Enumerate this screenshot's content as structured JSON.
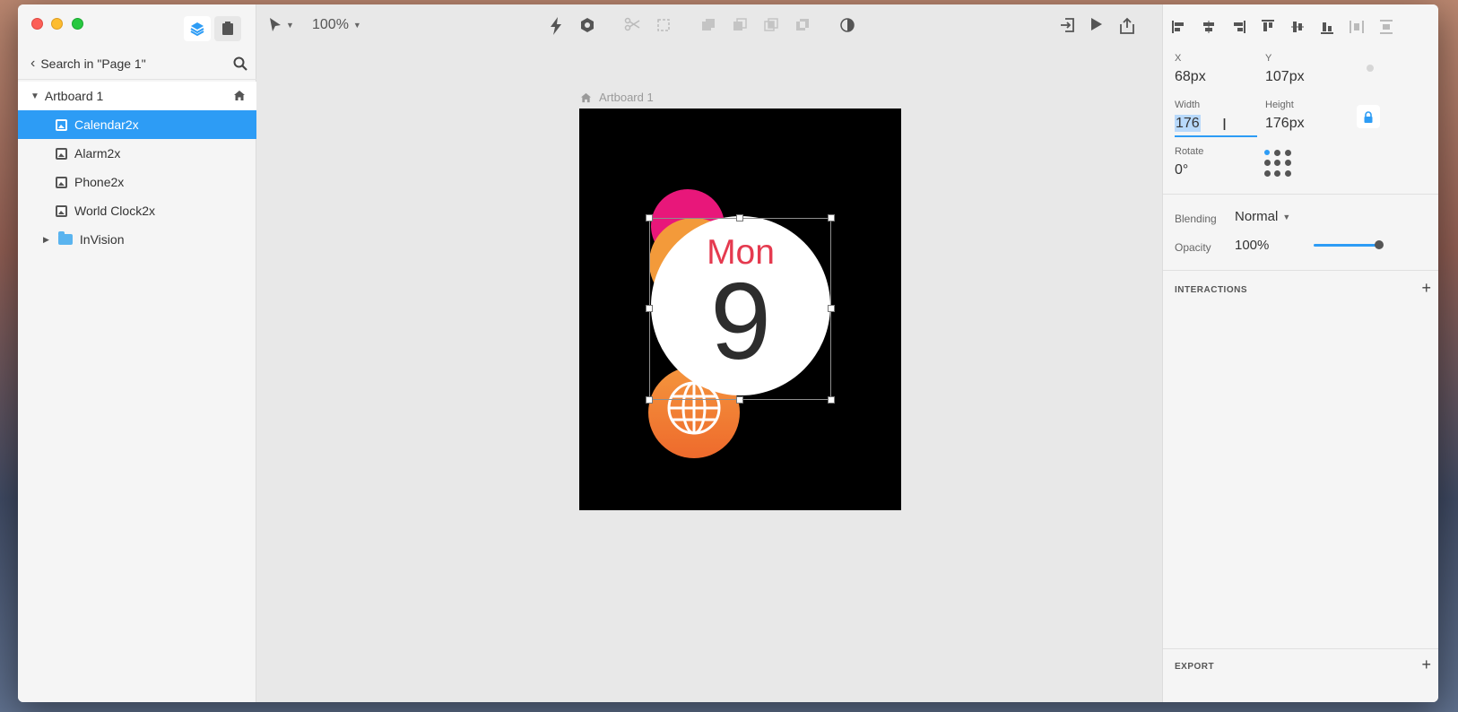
{
  "left_panel": {
    "search_label": "Search in \"Page 1\"",
    "artboard": "Artboard 1",
    "layers": [
      {
        "label": "Calendar2x",
        "selected": true
      },
      {
        "label": "Alarm2x",
        "selected": false
      },
      {
        "label": "Phone2x",
        "selected": false
      },
      {
        "label": "World Clock2x",
        "selected": false
      }
    ],
    "folder": "InVision"
  },
  "toolbar": {
    "zoom": "100%"
  },
  "canvas": {
    "artboard_label": "Artboard 1",
    "calendar_day": "Mon",
    "calendar_date": "9"
  },
  "properties": {
    "x_label": "X",
    "x_value": "68px",
    "y_label": "Y",
    "y_value": "107px",
    "width_label": "Width",
    "width_value": "176",
    "height_label": "Height",
    "height_value": "176px",
    "rotate_label": "Rotate",
    "rotate_value": "0°",
    "blending_label": "Blending",
    "blending_value": "Normal",
    "opacity_label": "Opacity",
    "opacity_value": "100%",
    "interactions_title": "INTERACTIONS",
    "export_title": "EXPORT"
  },
  "colors": {
    "accent": "#2d9cf5",
    "calendar_red": "#e53a4f"
  }
}
